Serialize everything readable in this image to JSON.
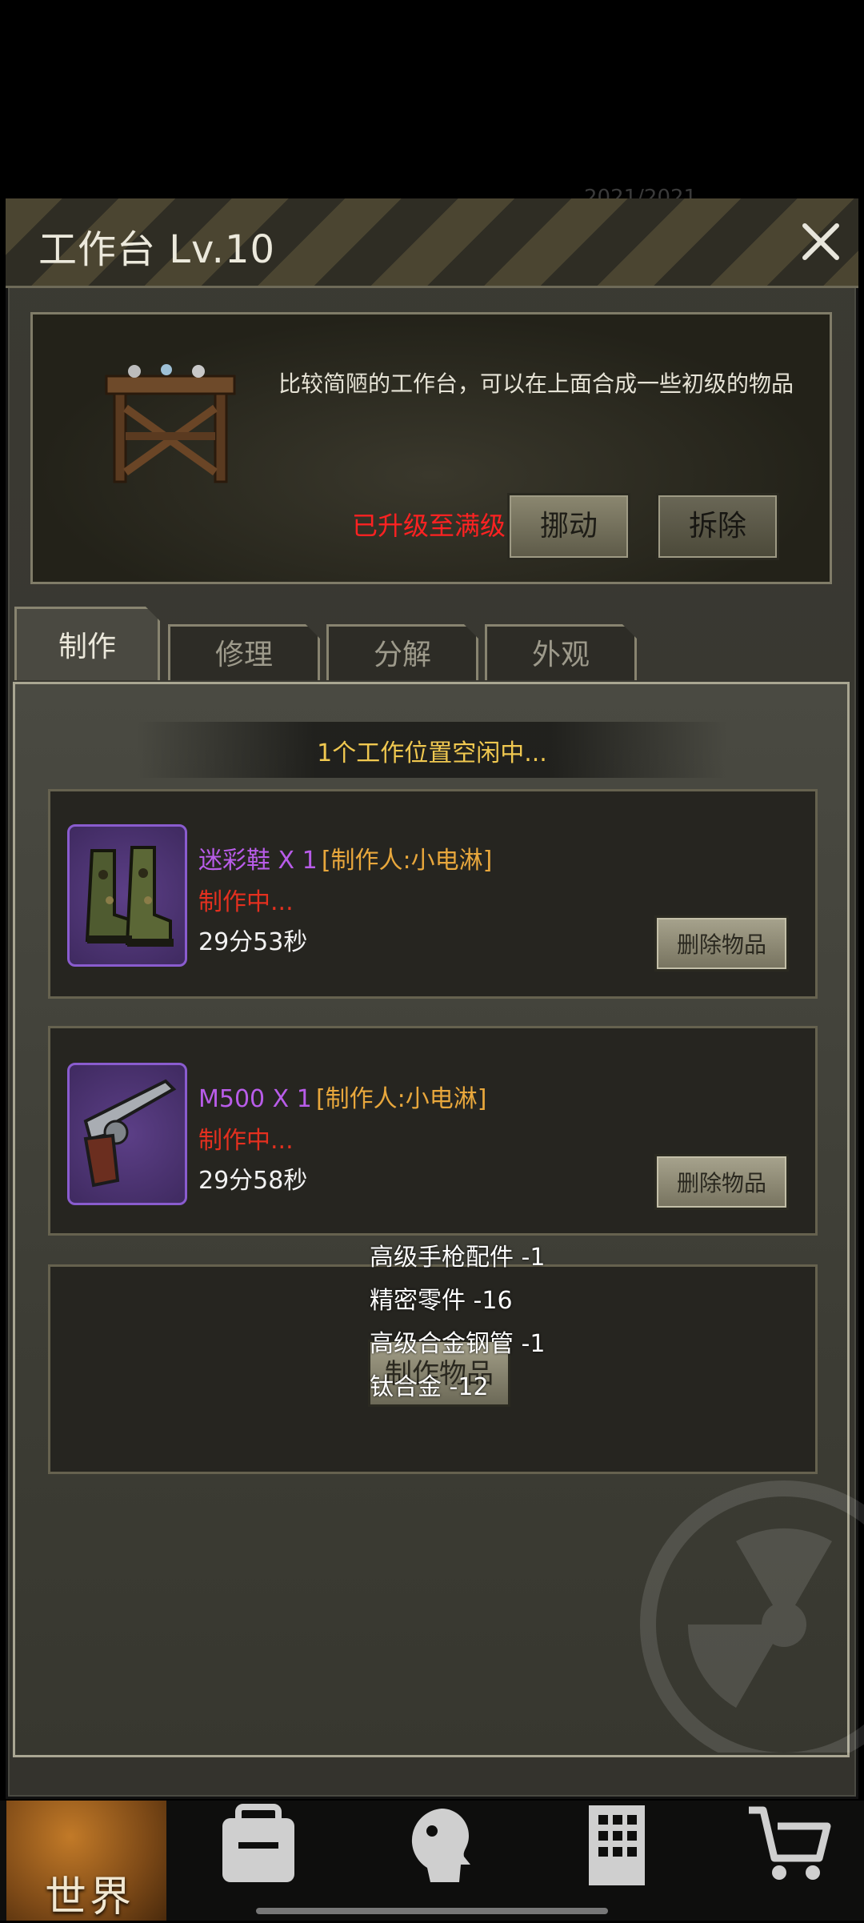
{
  "background_status": {
    "text": "2021/2021"
  },
  "header": {
    "title": "工作台 Lv.10",
    "close_icon": "close-icon"
  },
  "info": {
    "description": "比较简陋的工作台，可以在上面合成一些初级的物品",
    "max_level_text": "已升级至满级",
    "move_button": "挪动",
    "remove_button": "拆除"
  },
  "tabs": [
    {
      "label": "制作",
      "active": true
    },
    {
      "label": "修理",
      "active": false
    },
    {
      "label": "分解",
      "active": false
    },
    {
      "label": "外观",
      "active": false
    }
  ],
  "idle_text": "1个工作位置空闲中...",
  "queue": [
    {
      "name": "迷彩鞋 X 1",
      "maker": "[制作人:小电淋]",
      "status": "制作中...",
      "time": "29分53秒",
      "delete_button": "删除物品",
      "icon": "camo-boots-icon"
    },
    {
      "name": "M500 X 1",
      "maker": "[制作人:小电淋]",
      "status": "制作中...",
      "time": "29分58秒",
      "delete_button": "删除物品",
      "icon": "revolver-icon"
    }
  ],
  "materials": [
    "高级手枪配件 -1",
    "精密零件 -16",
    "高级合金钢管 -1",
    "钛合金 -12"
  ],
  "craft_button": "制作物品",
  "nav": {
    "world_label": "世界",
    "icons": [
      "backpack-icon",
      "character-icon",
      "building-icon",
      "shop-cart-icon"
    ]
  },
  "colors": {
    "item_name": "#b85ce8",
    "maker": "#e8a73c",
    "status": "#e4301f",
    "idle": "#f0c850",
    "max_level": "#ff2222"
  }
}
